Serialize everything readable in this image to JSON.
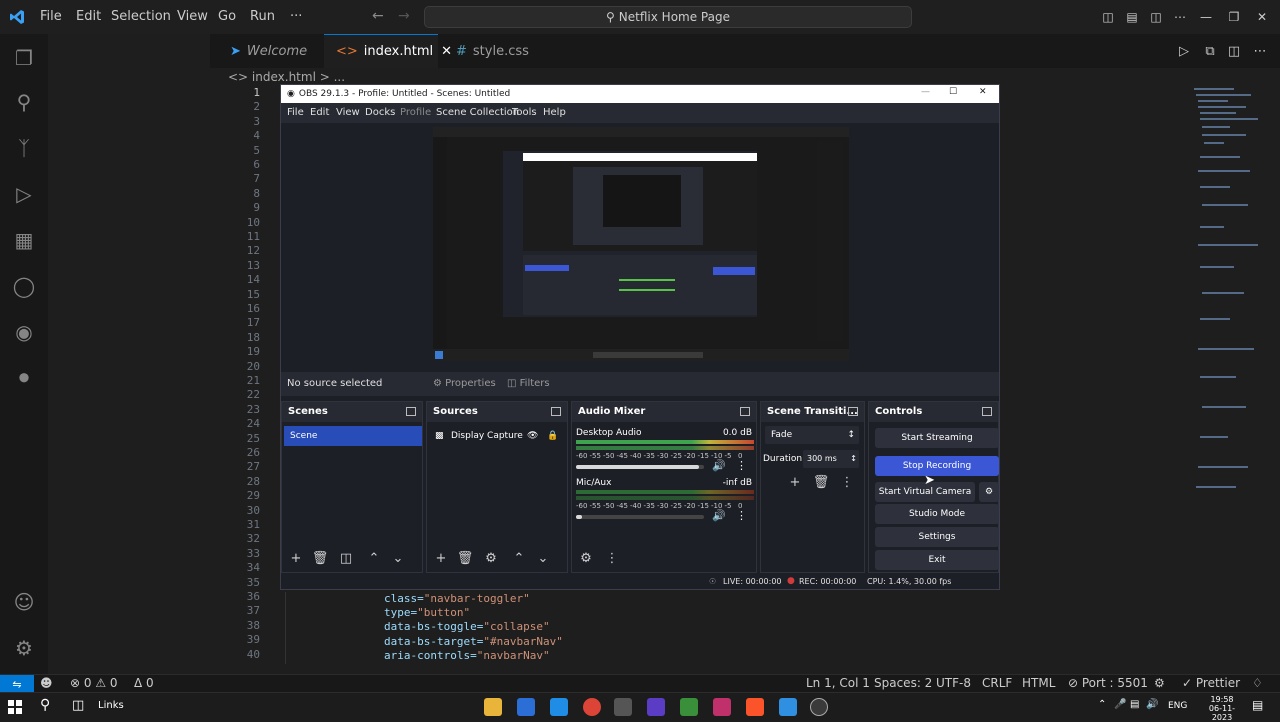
{
  "vscode": {
    "menu": [
      "File",
      "Edit",
      "Selection",
      "View",
      "Go",
      "Run",
      "···"
    ],
    "search": "Netflix Home Page",
    "tabs": [
      {
        "label": "Welcome",
        "icon": "vscode-icon"
      },
      {
        "label": "index.html",
        "icon": "html-icon"
      },
      {
        "label": "style.css",
        "icon": "css-icon"
      }
    ],
    "breadcrumb": "<> index.html > ...",
    "line_numbers": [
      "1",
      "2",
      "3",
      "4",
      "5",
      "6",
      "7",
      "8",
      "9",
      "10",
      "11",
      "12",
      "13",
      "14",
      "15",
      "16",
      "17",
      "18",
      "19",
      "20",
      "21",
      "22",
      "23",
      "24",
      "25",
      "26",
      "27",
      "28",
      "29",
      "30",
      "31",
      "32",
      "33",
      "34",
      "35",
      "36",
      "37",
      "38",
      "39",
      "40"
    ],
    "code_lines": [
      {
        "attr": "class=",
        "val": "\"navbar-toggler\""
      },
      {
        "attr": "type=",
        "val": "\"button\""
      },
      {
        "attr": "data-bs-toggle=",
        "val": "\"collapse\""
      },
      {
        "attr": "data-bs-target=",
        "val": "\"#navbarNav\""
      },
      {
        "attr": "aria-controls=",
        "val": "\"navbarNav\""
      }
    ],
    "status": {
      "errors": "⊗ 0 ⚠ 0",
      "ports": "Δ 0",
      "position": "Ln 1, Col 1",
      "spaces": "Spaces: 2",
      "encoding": "UTF-8",
      "eol": "CRLF",
      "language": "HTML",
      "port": "⊘ Port : 5501",
      "prettier": "✓ Prettier"
    }
  },
  "obs": {
    "title": "OBS 29.1.3 - Profile: Untitled - Scenes: Untitled",
    "menu": [
      "File",
      "Edit",
      "View",
      "Docks",
      "Profile",
      "Scene Collection",
      "Tools",
      "Help"
    ],
    "no_source": "No source selected",
    "properties": "Properties",
    "filters": "Filters",
    "scenes": {
      "title": "Scenes",
      "items": [
        "Scene"
      ]
    },
    "sources": {
      "title": "Sources",
      "items": [
        "Display Capture"
      ]
    },
    "audio": {
      "title": "Audio Mixer",
      "channels": [
        {
          "name": "Desktop Audio",
          "level": "0.0 dB",
          "volume": 0.96
        },
        {
          "name": "Mic/Aux",
          "level": "-inf dB",
          "volume": 0.05
        }
      ],
      "scale": [
        "-60",
        "-55",
        "-50",
        "-45",
        "-40",
        "-35",
        "-30",
        "-25",
        "-20",
        "-15",
        "-10",
        "-5",
        "0"
      ]
    },
    "transitions": {
      "title": "Scene Transiti...",
      "type": "Fade",
      "duration_label": "Duration",
      "duration": "300 ms"
    },
    "controls": {
      "title": "Controls",
      "buttons": [
        "Start Streaming",
        "Stop Recording",
        "Start Virtual Camera",
        "Studio Mode",
        "Settings",
        "Exit"
      ]
    },
    "status": {
      "live": "LIVE: 00:00:00",
      "rec": "REC: 00:00:00",
      "cpu": "CPU: 1.4%, 30.00 fps"
    }
  },
  "taskbar": {
    "links": "Links",
    "lang": "ENG",
    "time": "19:58",
    "date": "06-11-2023"
  }
}
